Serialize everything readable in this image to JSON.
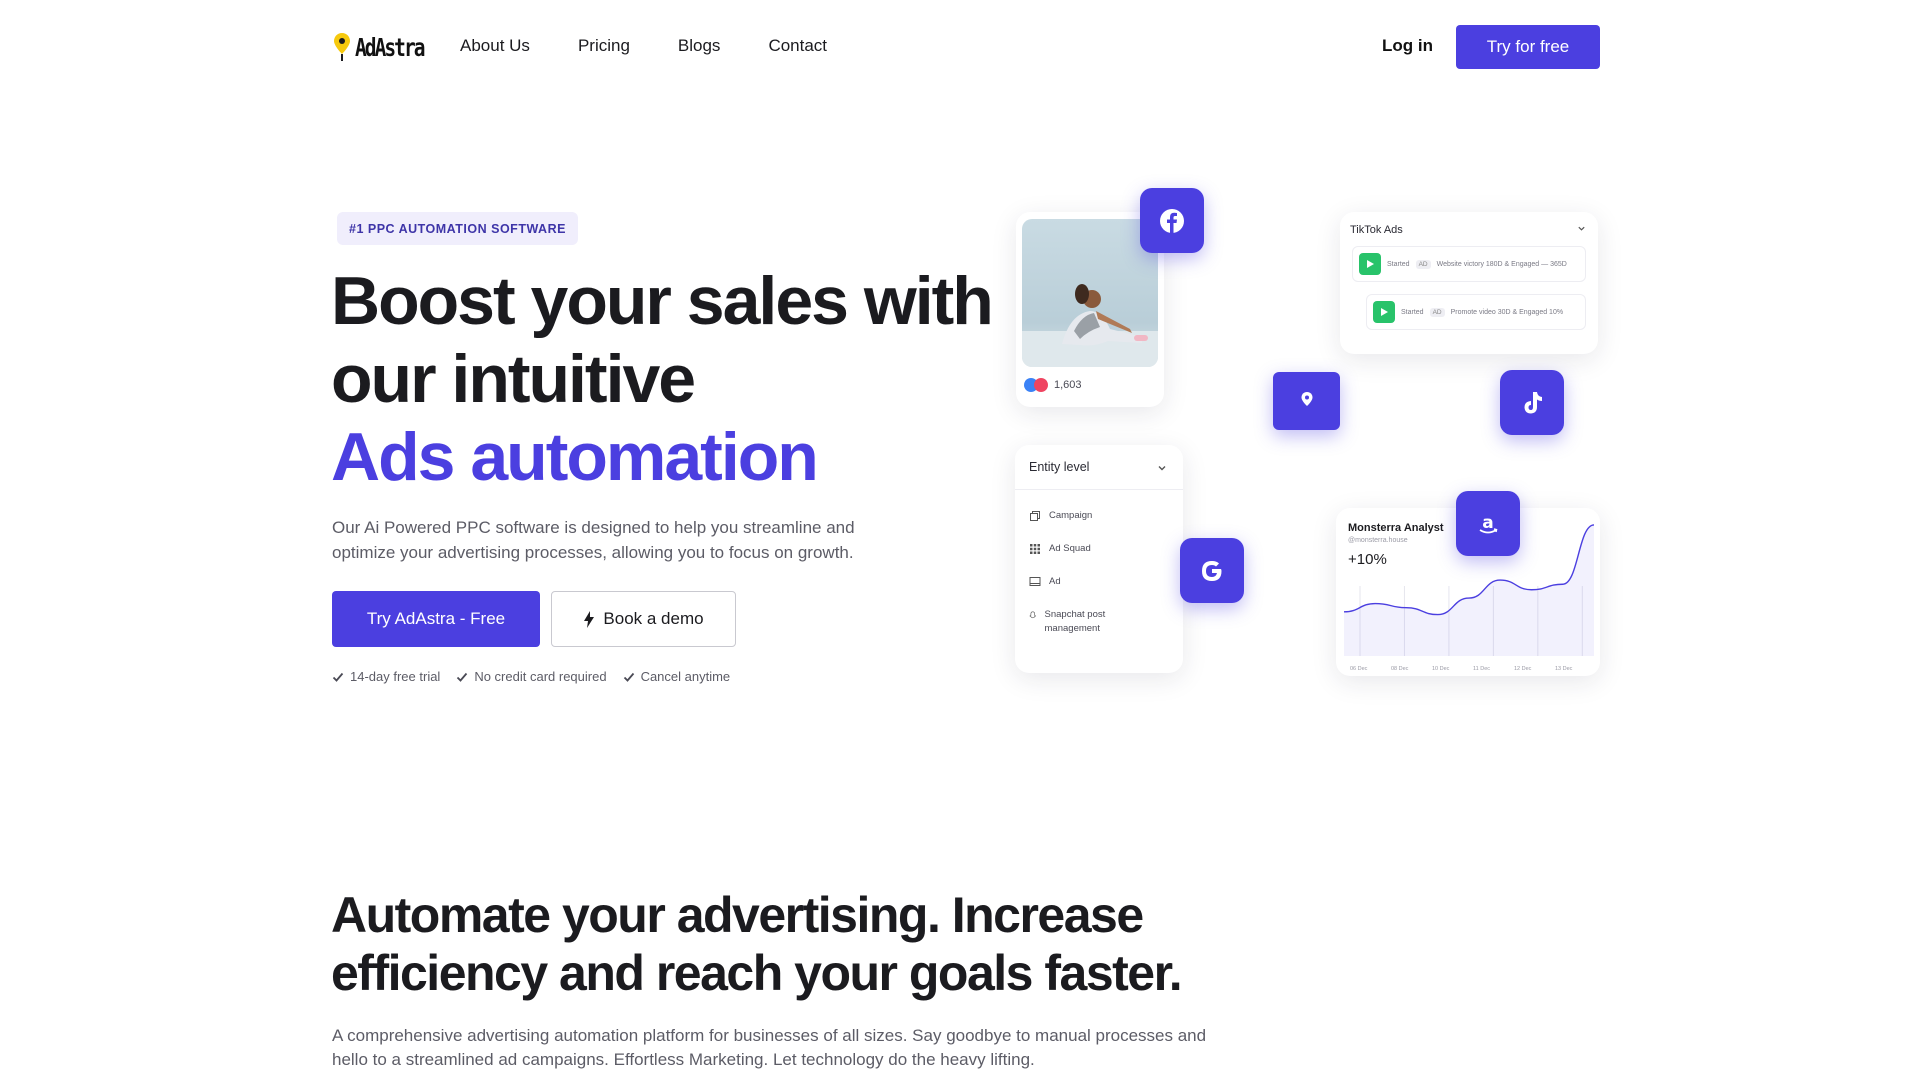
{
  "nav": {
    "logo_text": "AdAstra",
    "links": [
      "About Us",
      "Pricing",
      "Blogs",
      "Contact"
    ],
    "login_label": "Log in",
    "cta_label": "Try for free"
  },
  "hero": {
    "badge": "#1 PPC AUTOMATION SOFTWARE",
    "headline_line1": "Boost your sales with",
    "headline_line2": "our intuitive",
    "headline_accent": "Ads automation",
    "subtitle": "Our Ai Powered PPC software is designed to help you streamline and optimize your advertising processes, allowing you to focus on growth.",
    "primary_button": "Try AdAstra - Free",
    "secondary_button": "Book a demo",
    "perks": [
      "14-day free trial",
      "No credit card required",
      "Cancel anytime"
    ]
  },
  "collage": {
    "photo_card": {
      "reaction_count": "1,603"
    },
    "tiktok_card": {
      "title": "TikTok Ads",
      "rows": [
        {
          "status": "Started",
          "tag": "AD",
          "text": "Website victory 180D & Engaged — 365D"
        },
        {
          "status": "Started",
          "tag": "AD",
          "text": "Promote video 30D & Engaged 10%"
        }
      ]
    },
    "entity_card": {
      "title": "Entity level",
      "items": [
        "Campaign",
        "Ad Squad",
        "Ad",
        "Snapchat post management"
      ]
    },
    "chart_card": {
      "title": "Monsterra Analyst",
      "handle": "@monsterra.house",
      "value": "+10%",
      "x_labels": [
        "06 Dec",
        "08 Dec",
        "10 Dec",
        "11 Dec",
        "12 Dec",
        "13 Dec"
      ],
      "trend": [
        0.32,
        0.38,
        0.35,
        0.3,
        0.42,
        0.55,
        0.48,
        0.52,
        0.95
      ]
    },
    "icons": [
      "facebook-icon",
      "tiktok-icon",
      "google-icon",
      "amazon-icon",
      "pin-icon"
    ],
    "accent_color": "#4b3fe0"
  },
  "section2": {
    "title_line1": "Automate your advertising. Increase",
    "title_line2": "efficiency and reach your goals faster.",
    "subtitle": "A comprehensive advertising automation platform for businesses of all sizes. Say goodbye to manual processes and hello to a streamlined ad campaigns. Effortless Marketing. Let technology do the heavy lifting."
  }
}
